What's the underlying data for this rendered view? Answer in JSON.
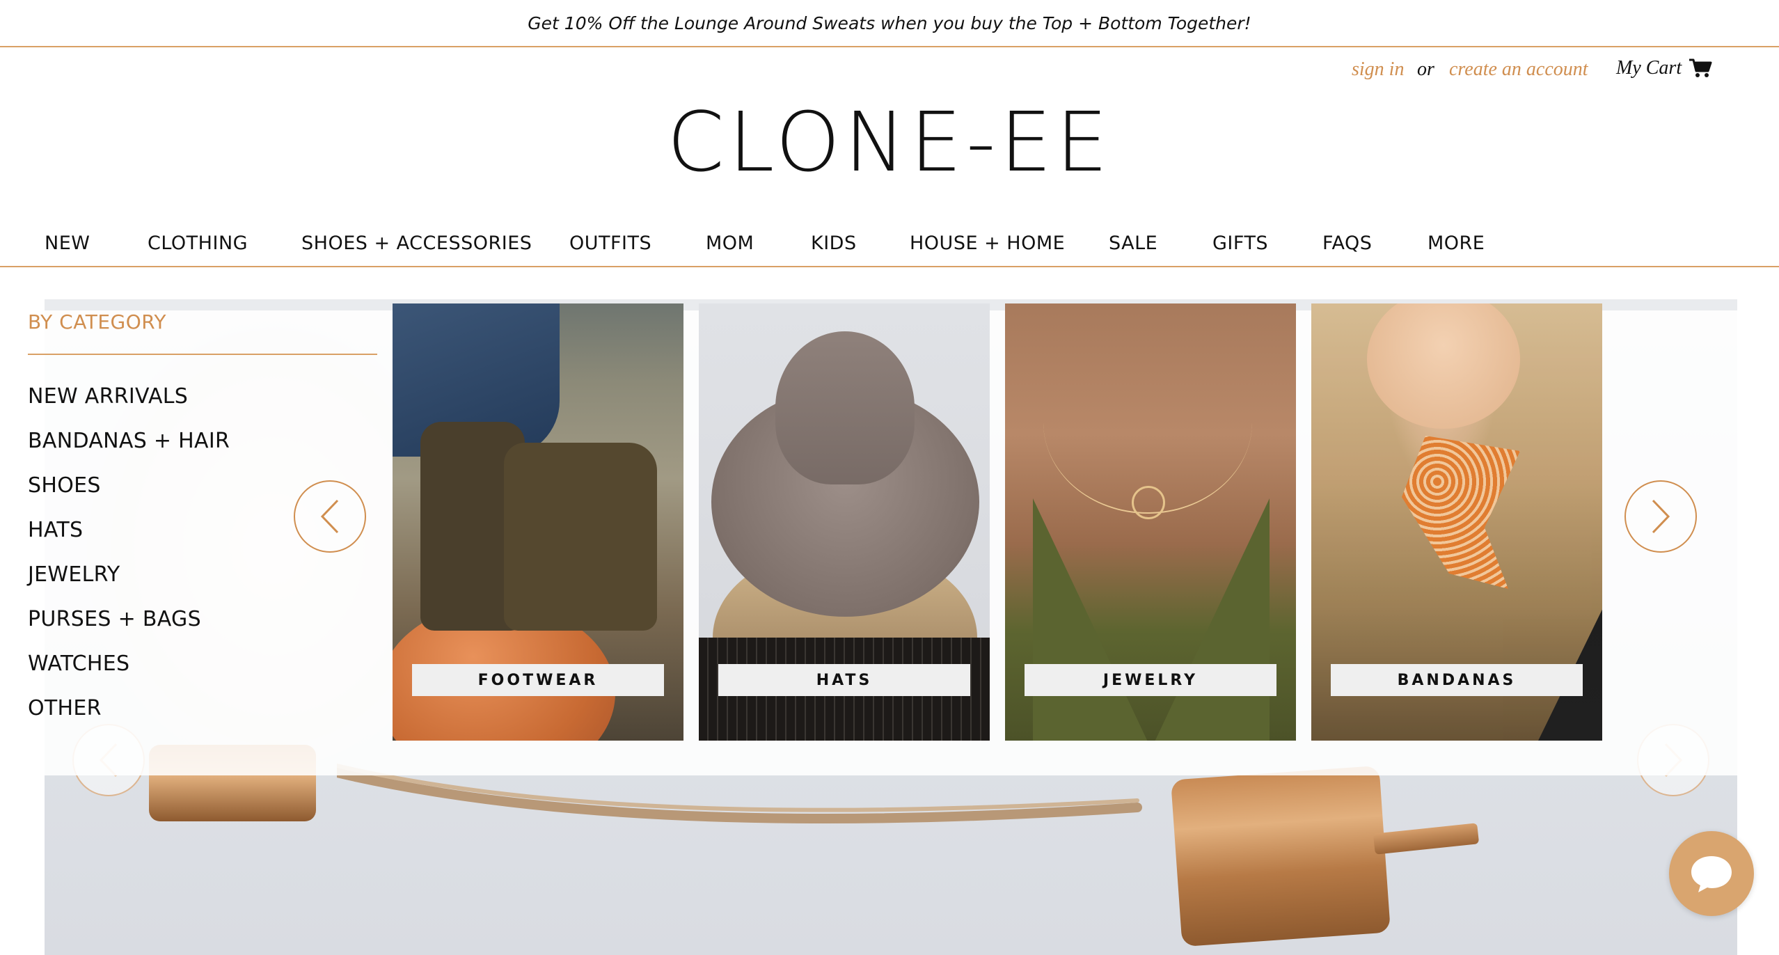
{
  "announcement": "Get 10% Off the Lounge Around Sweats when you buy the Top + Bottom Together!",
  "account": {
    "sign_in": "sign in",
    "or": "or",
    "create_account": "create an account",
    "cart": "My Cart"
  },
  "logo": "CLONE-EE",
  "nav": [
    "NEW",
    "CLOTHING",
    "SHOES + ACCESSORIES",
    "OUTFITS",
    "MOM",
    "KIDS",
    "HOUSE + HOME",
    "SALE",
    "GIFTS",
    "FAQS",
    "MORE"
  ],
  "mega_menu": {
    "heading": "BY CATEGORY",
    "categories": [
      "NEW ARRIVALS",
      "BANDANAS + HAIR",
      "SHOES",
      "HATS",
      "JEWELRY",
      "PURSES + BAGS",
      "WATCHES",
      "OTHER"
    ],
    "tiles": [
      "FOOTWEAR",
      "HATS",
      "JEWELRY",
      "BANDANAS"
    ]
  },
  "icons": {
    "cart": "shopping-cart-icon",
    "prev": "chevron-left-icon",
    "next": "chevron-right-icon",
    "chat": "chat-bubble-icon"
  },
  "colors": {
    "accent": "#d08e4f",
    "rule": "#d9a066",
    "chat_button": "#d9a56f"
  }
}
